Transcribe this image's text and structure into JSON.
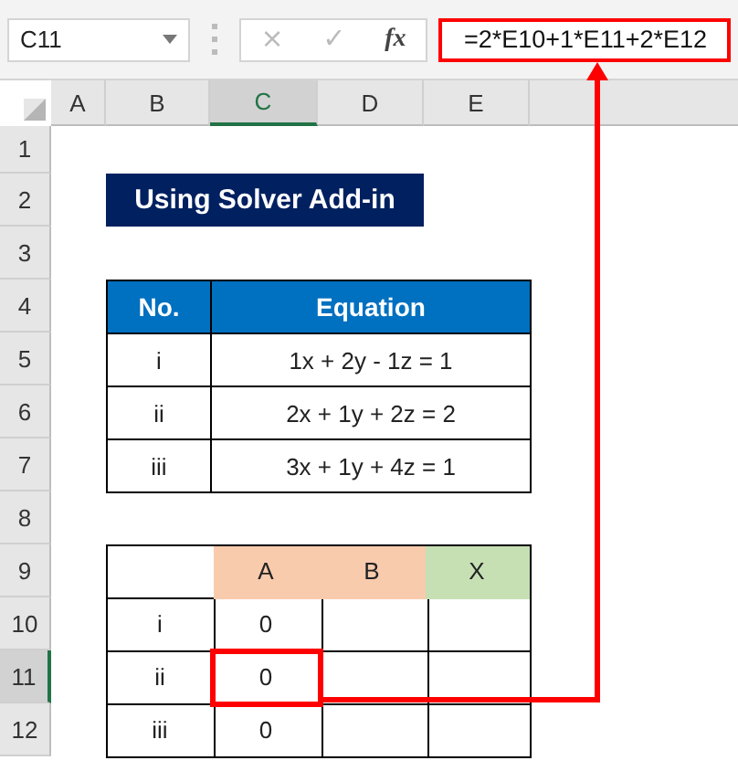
{
  "formula_bar": {
    "name_box": "C11",
    "cancel": "×",
    "enter": "✓",
    "fx": "fx",
    "formula": "=2*E10+1*E11+2*E12",
    "highlighted": true
  },
  "column_headers": [
    {
      "label": "A",
      "selected": false
    },
    {
      "label": "B",
      "selected": false
    },
    {
      "label": "C",
      "selected": true
    },
    {
      "label": "D",
      "selected": false
    },
    {
      "label": "E",
      "selected": false
    }
  ],
  "row_headers": [
    {
      "label": "1",
      "selected": false
    },
    {
      "label": "2",
      "selected": false
    },
    {
      "label": "3",
      "selected": false
    },
    {
      "label": "4",
      "selected": false
    },
    {
      "label": "5",
      "selected": false
    },
    {
      "label": "6",
      "selected": false
    },
    {
      "label": "7",
      "selected": false
    },
    {
      "label": "8",
      "selected": false
    },
    {
      "label": "9",
      "selected": false
    },
    {
      "label": "10",
      "selected": false
    },
    {
      "label": "11",
      "selected": true
    },
    {
      "label": "12",
      "selected": false
    }
  ],
  "title": "Using Solver Add-in",
  "equations": {
    "columns": [
      "No.",
      "Equation"
    ],
    "rows": [
      {
        "no": "i",
        "equation": "1x + 2y - 1z = 1"
      },
      {
        "no": "ii",
        "equation": "2x + 1y + 2z = 2"
      },
      {
        "no": "iii",
        "equation": "3x + 1y + 4z = 1"
      }
    ]
  },
  "solver": {
    "columns": [
      {
        "label": "A",
        "color": "#f8cbad"
      },
      {
        "label": "B",
        "color": "#f8cbad"
      },
      {
        "label": "X",
        "color": "#c6e0b4"
      }
    ],
    "rows": [
      {
        "label": "i",
        "a": "0",
        "highlighted": false
      },
      {
        "label": "ii",
        "a": "0",
        "highlighted": true
      },
      {
        "label": "iii",
        "a": "0",
        "highlighted": false
      }
    ]
  }
}
